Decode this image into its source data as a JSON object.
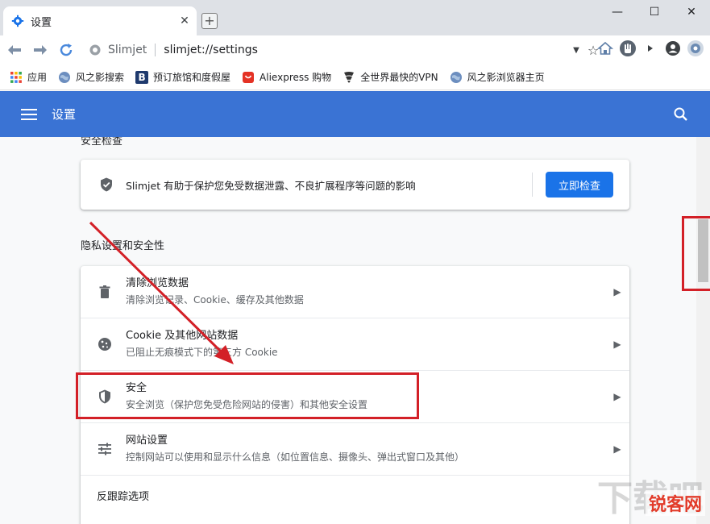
{
  "browser": {
    "tab_title": "设置",
    "tab_close": "✕",
    "new_tab": "+",
    "window_controls": [
      "—",
      "☐",
      "✕"
    ],
    "omnibox_brand": "Slimjet",
    "omnibox_url": "slimjet://settings"
  },
  "bookmarks": [
    {
      "label": "应用",
      "icon": "apps-grid-icon"
    },
    {
      "label": "风之影搜索",
      "icon": "globe-icon"
    },
    {
      "label": "预订旅馆和度假屋",
      "icon": "booking-icon"
    },
    {
      "label": "Aliexpress 购物",
      "icon": "aliexpress-icon"
    },
    {
      "label": "全世界最快的VPN",
      "icon": "vpn-icon"
    },
    {
      "label": "风之影浏览器主页",
      "icon": "globe-icon"
    }
  ],
  "settings": {
    "title": "设置",
    "prev_section_cut": "安全检查",
    "safety_check": {
      "text": "Slimjet 有助于保护您免受数据泄露、不良扩展程序等问题的影响",
      "button": "立即检查"
    },
    "privacy_section_title": "隐私设置和安全性",
    "privacy_rows": [
      {
        "title": "清除浏览数据",
        "subtitle": "清除浏览记录、Cookie、缓存及其他数据",
        "icon": "trash-icon"
      },
      {
        "title": "Cookie 及其他网站数据",
        "subtitle": "已阻止无痕模式下的第三方 Cookie",
        "icon": "cookie-icon"
      },
      {
        "title": "安全",
        "subtitle": "安全浏览（保护您免受危险网站的侵害）和其他安全设置",
        "icon": "shield-icon"
      },
      {
        "title": "网站设置",
        "subtitle": "控制网站可以使用和显示什么信息（如位置信息、摄像头、弹出式窗口及其他）",
        "icon": "sliders-icon"
      }
    ],
    "tracking_row": "反跟踪选项"
  },
  "watermark": "锐客网",
  "watermark_bg": "下载吧",
  "colors": {
    "header_blue": "#3a73d4",
    "button_blue": "#1a73e8",
    "annotation_red": "#d32027"
  }
}
